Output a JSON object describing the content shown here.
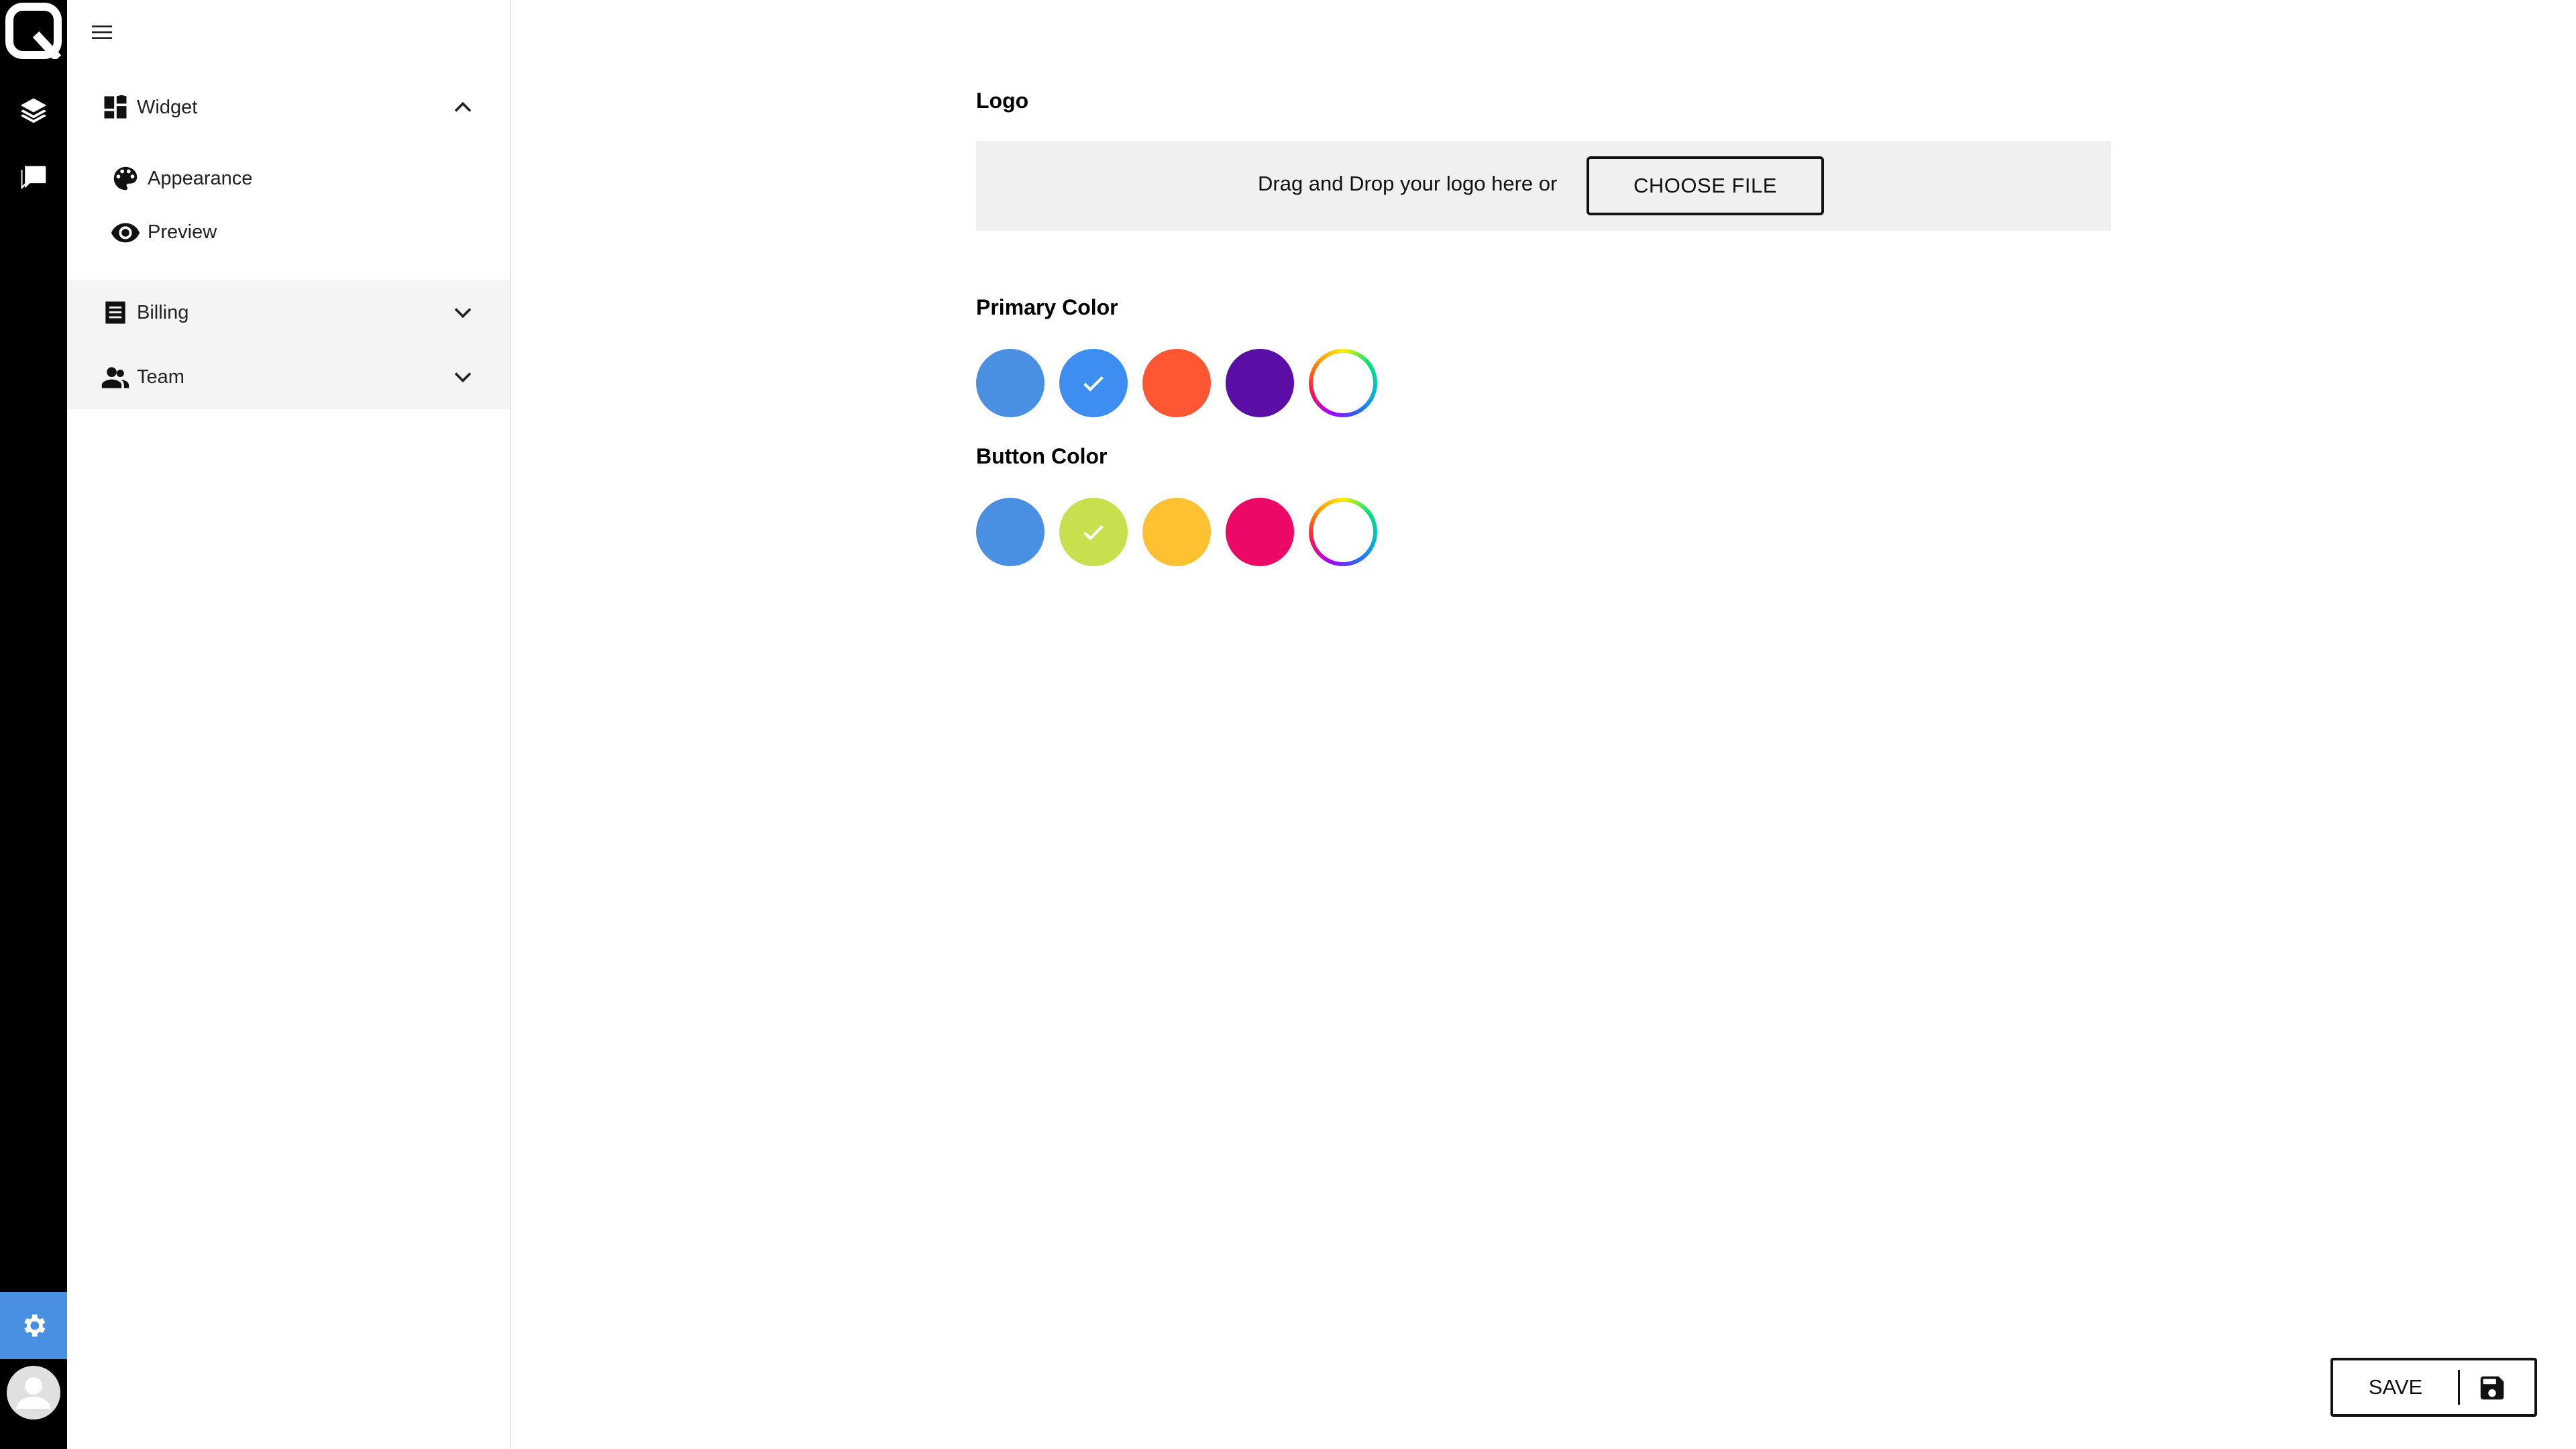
{
  "rail": {
    "items": [
      "layers-icon",
      "chat-icon"
    ],
    "settings_icon": "gear-icon",
    "avatar_icon": "person-icon",
    "active_color": "#4a90e2"
  },
  "sidebar": {
    "groups": [
      {
        "label": "Widget",
        "icon": "dashboard-icon",
        "expanded": true,
        "items": [
          {
            "label": "Appearance",
            "icon": "palette-icon"
          },
          {
            "label": "Preview",
            "icon": "eye-icon"
          }
        ]
      },
      {
        "label": "Billing",
        "icon": "receipt-icon",
        "expanded": false
      },
      {
        "label": "Team",
        "icon": "people-icon",
        "expanded": false
      }
    ]
  },
  "main": {
    "logo": {
      "title": "Logo",
      "dropzone_text": "Drag and Drop your logo here or",
      "choose_label": "CHOOSE FILE"
    },
    "primary_color": {
      "title": "Primary Color",
      "swatches": [
        "#4a90e2",
        "#3d8ef0",
        "#ff5733",
        "#5b0ea6",
        "custom"
      ],
      "selected_index": 1
    },
    "button_color": {
      "title": "Button Color",
      "swatches": [
        "#4a90e2",
        "#c8e04e",
        "#fdc131",
        "#ec0867",
        "custom"
      ],
      "selected_index": 1
    },
    "save_label": "SAVE"
  }
}
